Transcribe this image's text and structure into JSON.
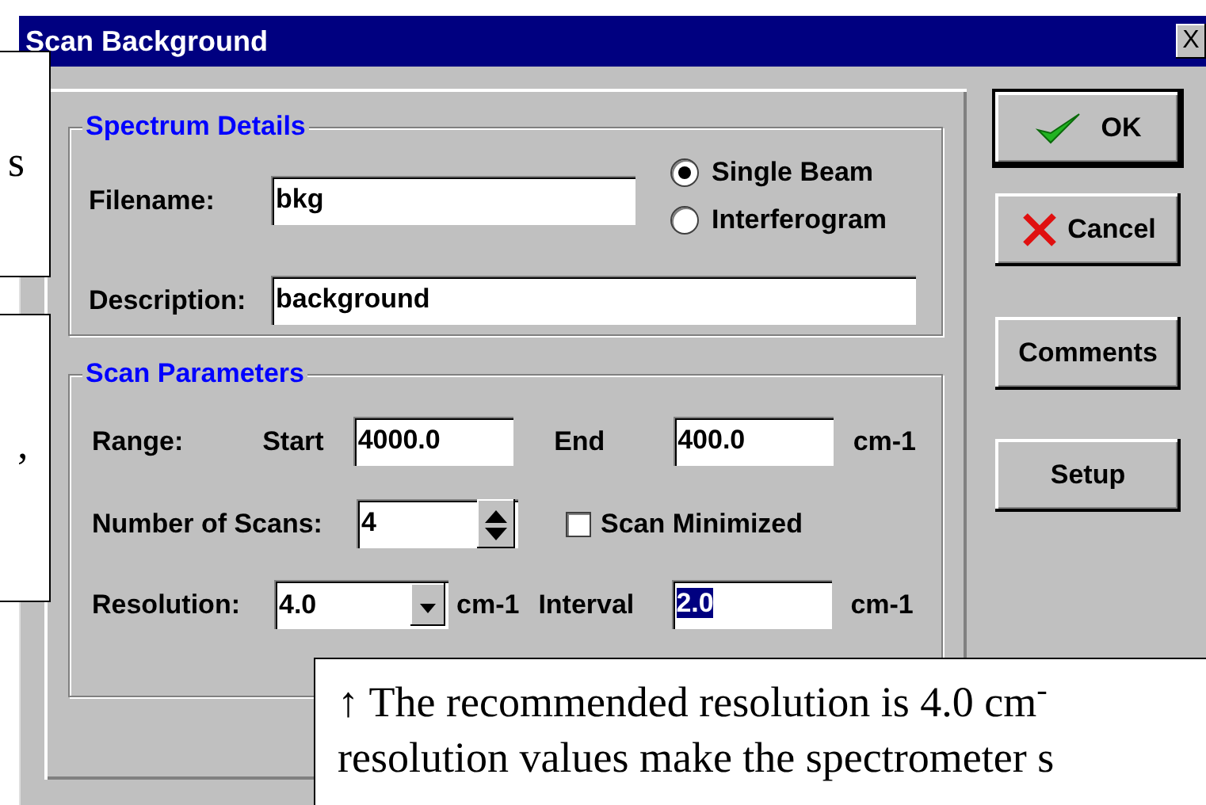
{
  "window": {
    "title": "Scan Background",
    "close_label": "X"
  },
  "spectrum_details": {
    "title": "Spectrum Details",
    "filename": {
      "label": "Filename:",
      "value": "bkg"
    },
    "description": {
      "label": "Description:",
      "value": "background"
    },
    "beam_options": [
      {
        "label": "Single Beam",
        "selected": true
      },
      {
        "label": "Interferogram",
        "selected": false
      }
    ]
  },
  "scan_parameters": {
    "title": "Scan Parameters",
    "range": {
      "label": "Range:",
      "start_label": "Start",
      "start": "4000.0",
      "end_label": "End",
      "end": "400.0",
      "unit": "cm-1"
    },
    "number_of_scans": {
      "label": "Number of Scans:",
      "value": "4"
    },
    "scan_minimized": {
      "label": "Scan Minimized",
      "checked": false
    },
    "resolution": {
      "label": "Resolution:",
      "value": "4.0",
      "unit": "cm-1"
    },
    "interval": {
      "label": "Interval",
      "value": "2.0",
      "text_selected": true,
      "unit": "cm-1"
    }
  },
  "buttons": [
    {
      "kind": "ok",
      "label": "OK",
      "default": true
    },
    {
      "kind": "cancel",
      "label": "Cancel",
      "default": false
    },
    {
      "kind": "plain",
      "label": "Comments",
      "default": false
    },
    {
      "kind": "plain",
      "label": "Setup",
      "default": false
    }
  ],
  "callouts": [
    {
      "lines": [
        "s"
      ]
    },
    {
      "lines": [
        ","
      ]
    },
    {
      "lines": [
        "↑ The recommended resolution is 4.0 cm$^{-}$",
        "resolution values make the spectrometer s"
      ]
    }
  ]
}
